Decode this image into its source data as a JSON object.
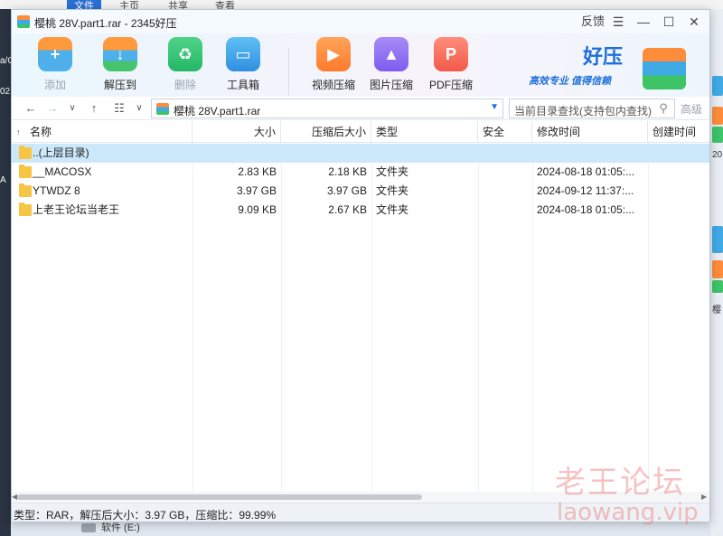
{
  "background": {
    "tabs": [
      "文件",
      "主页",
      "共享",
      "查看"
    ],
    "drive_label": "软件 (E:)",
    "left_snippets": [
      "a/C",
      "02",
      "A"
    ],
    "right_snippets": [
      "20",
      "樱"
    ]
  },
  "window": {
    "title": "樱桃 28V.part1.rar - 2345好压",
    "controls": {
      "feedback": "反馈",
      "menu": "☰",
      "minimize": "—",
      "maximize": "☐",
      "close": "✕"
    }
  },
  "toolbar": {
    "add": "添加",
    "extract": "解压到",
    "delete": "删除",
    "tools": "工具箱",
    "video": "视频压缩",
    "image": "图片压缩",
    "pdf": "PDF压缩",
    "brand_name": "好压",
    "brand_slogan": "高效专业  值得信赖"
  },
  "navigation": {
    "back": "←",
    "forward": "→",
    "dropdown": "∨",
    "up": "↑",
    "view": "☷",
    "view_dropdown": "∨",
    "path": "樱桃 28V.part1.rar",
    "search_placeholder": "当前目录查找(支持包内查找)",
    "advanced": "高级"
  },
  "table": {
    "headers": {
      "name": "名称",
      "size": "大小",
      "packed": "压缩后大小",
      "type": "类型",
      "security": "安全",
      "modified": "修改时间",
      "created": "创建时间"
    },
    "rows": [
      {
        "name": "..(上层目录)",
        "size": "",
        "packed": "",
        "type": "",
        "modified": ""
      },
      {
        "name": "__MACOSX",
        "size": "2.83 KB",
        "packed": "2.18 KB",
        "type": "文件夹",
        "modified": "2024-08-18 01:05:..."
      },
      {
        "name": "YTWDZ 8",
        "size": "3.97 GB",
        "packed": "3.97 GB",
        "type": "文件夹",
        "modified": "2024-09-12 11:37:..."
      },
      {
        "name": "上老王论坛当老王",
        "size": "9.09 KB",
        "packed": "2.67 KB",
        "type": "文件夹",
        "modified": "2024-08-18 01:05:..."
      }
    ]
  },
  "statusbar": {
    "text": "类型：RAR，解压后大小：3.97 GB，压缩比：99.99%"
  },
  "watermark": {
    "line1": "老王论坛",
    "line2": "laowang.vip"
  },
  "colors": {
    "accent": "#1e6fd9",
    "selection": "#cce8fb",
    "folder": "#f7c544"
  }
}
